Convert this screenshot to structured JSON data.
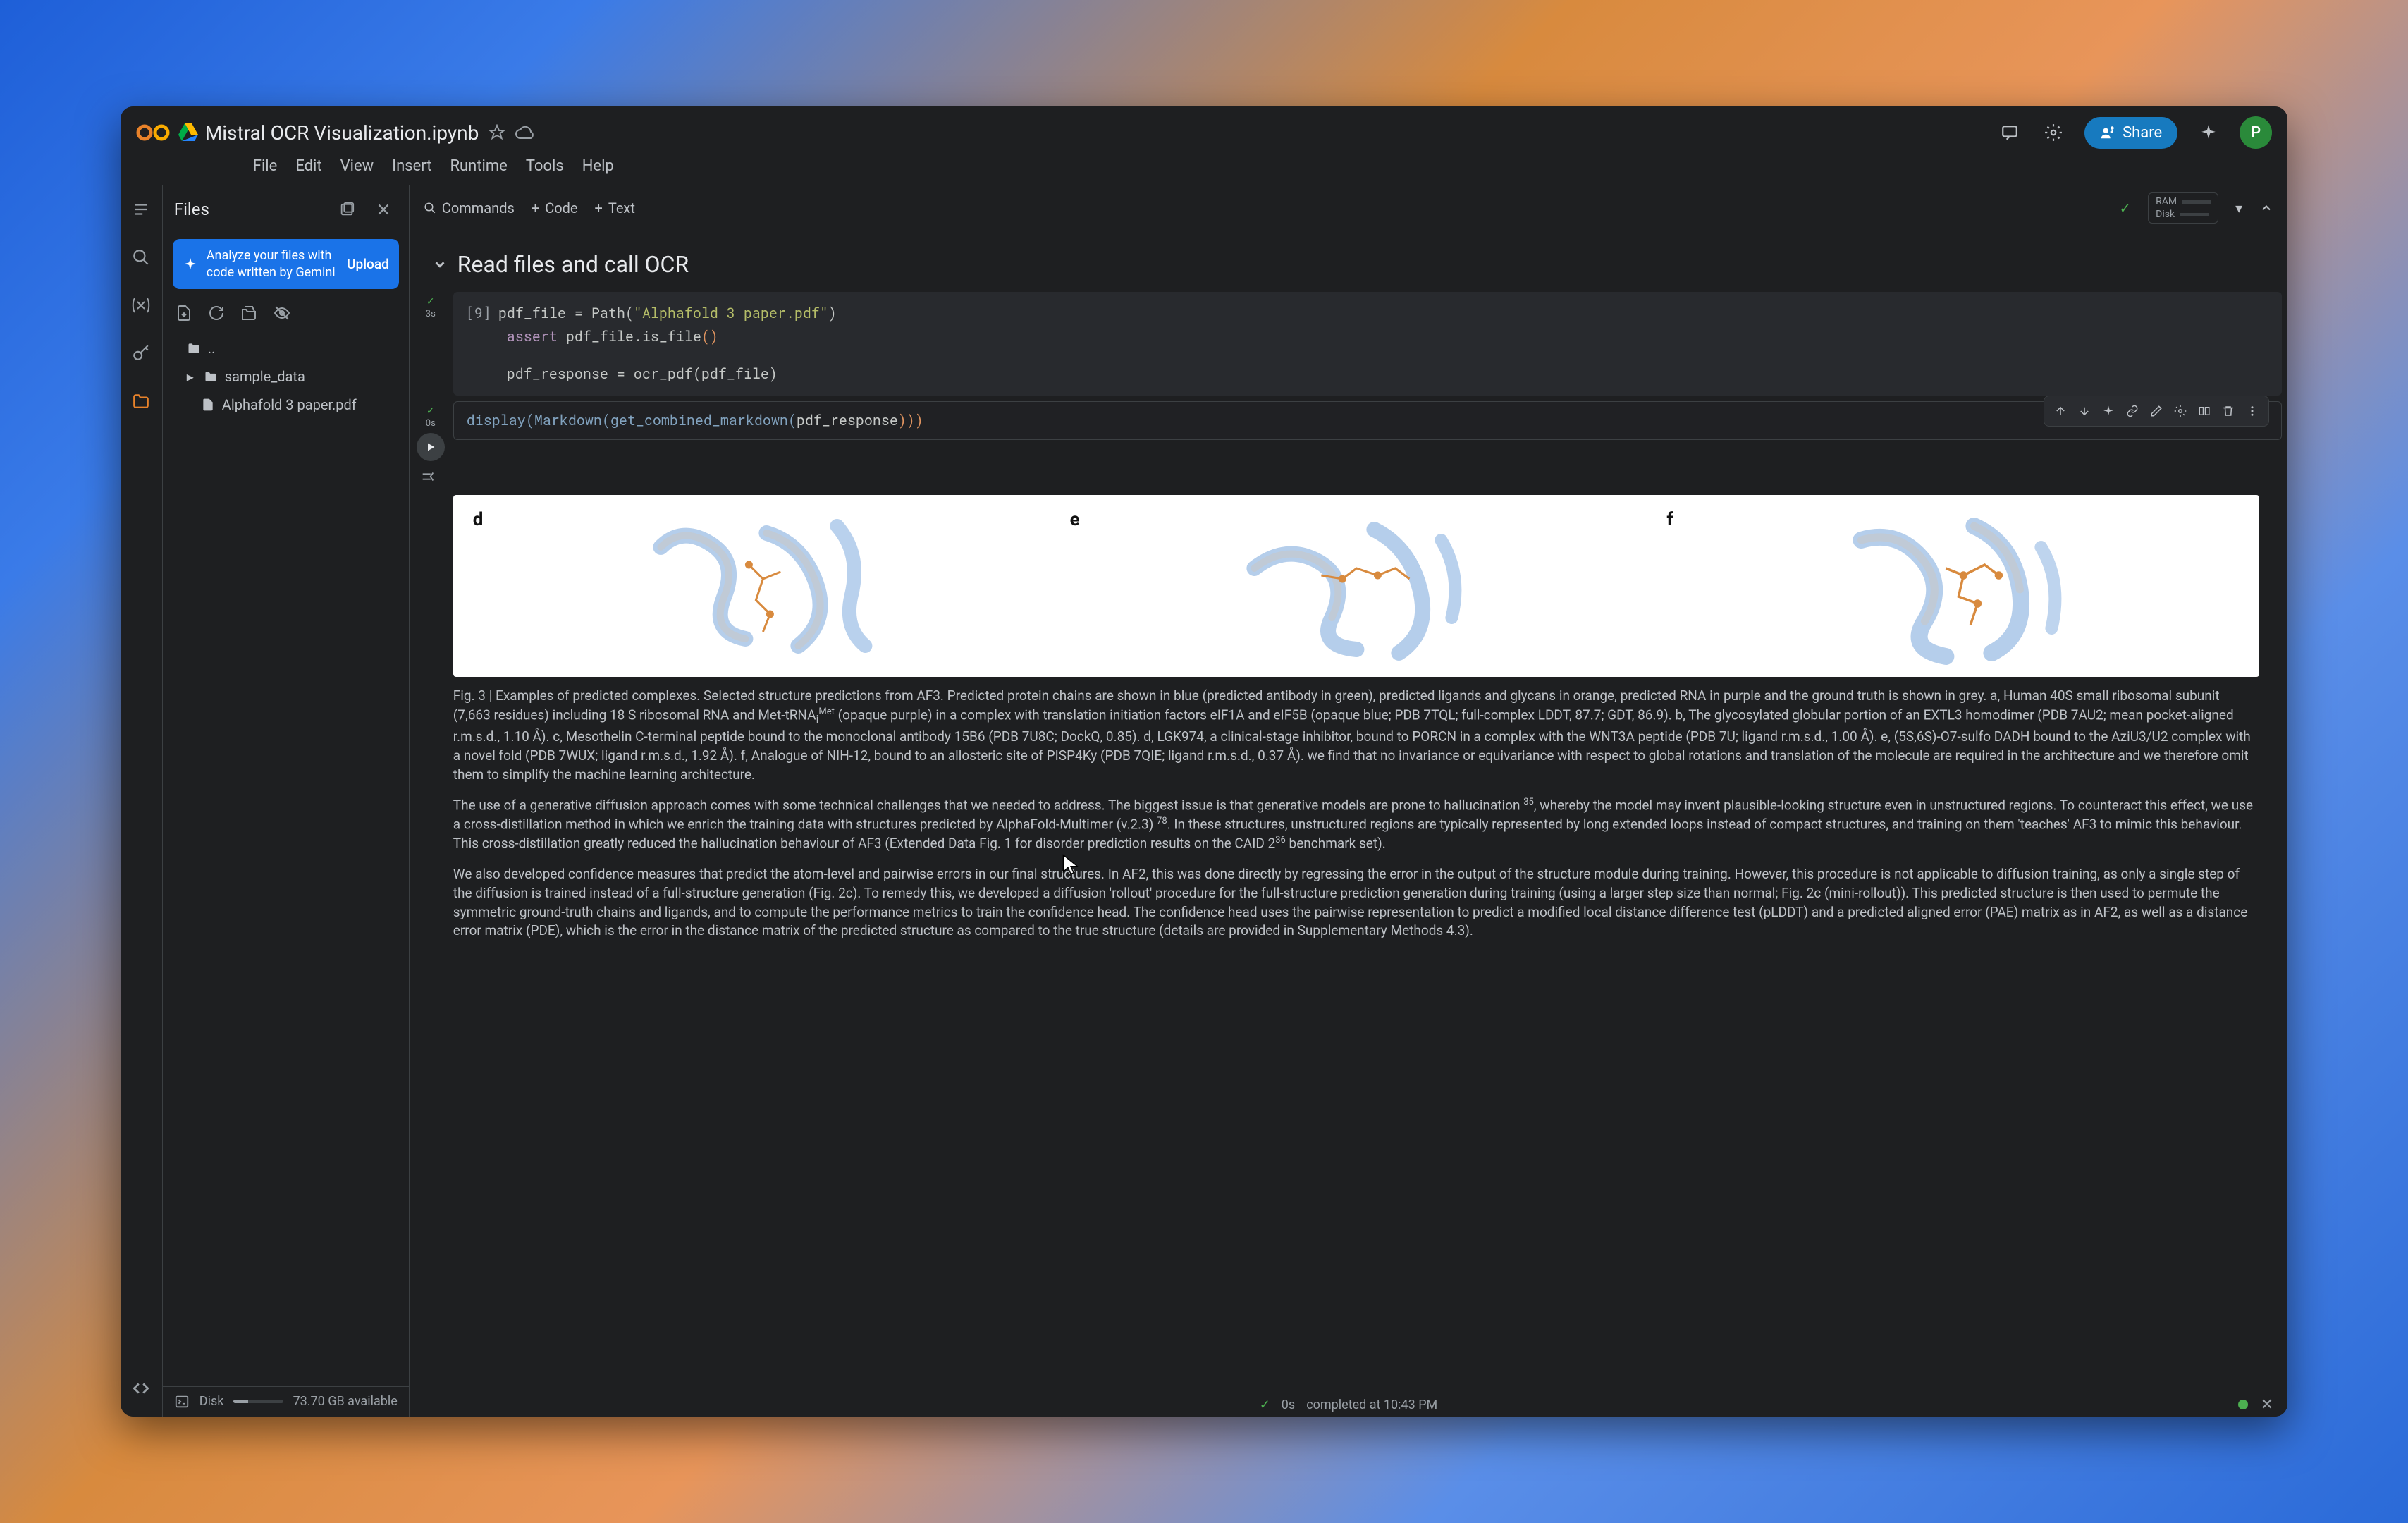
{
  "header": {
    "filename": "Mistral OCR Visualization.ipynb",
    "share_label": "Share",
    "avatar_initial": "P"
  },
  "menu": {
    "file": "File",
    "edit": "Edit",
    "view": "View",
    "insert": "Insert",
    "runtime": "Runtime",
    "tools": "Tools",
    "help": "Help"
  },
  "files_panel": {
    "title": "Files",
    "gemini_text": "Analyze your files with code written by Gemini",
    "upload": "Upload",
    "tree": {
      "parent": "..",
      "folder": "sample_data",
      "file": "Alphafold 3 paper.pdf"
    },
    "disk_label": "Disk",
    "disk_avail": "73.70 GB available"
  },
  "toolbar": {
    "commands": "Commands",
    "code": "Code",
    "text": "Text",
    "ram": "RAM",
    "disk": "Disk"
  },
  "section": {
    "title": "Read files and call OCR"
  },
  "cell1": {
    "prompt": "[9]",
    "time": "3s",
    "code_l1a": "pdf_file ",
    "code_l1b": "= Path(",
    "code_l1c": "\"Alphafold 3 paper.pdf\"",
    "code_l1d": ")",
    "code_l2a": "assert",
    "code_l2b": " pdf_file.is_file",
    "code_l2c": "()",
    "code_l3a": "pdf_response ",
    "code_l3b": "= ocr_pdf(",
    "code_l3c": "pdf_file",
    "code_l3d": ")"
  },
  "cell2": {
    "time": "0s",
    "code_a": "display(",
    "code_b": "Markdown(",
    "code_c": "get_combined_markdown(",
    "code_d": "pdf_response",
    "code_e": ")))"
  },
  "figure": {
    "labels": {
      "d": "d",
      "e": "e",
      "f": "f"
    }
  },
  "output": {
    "p1": "Fig. 3 | Examples of predicted complexes. Selected structure predictions from AF3. Predicted protein chains are shown in blue (predicted antibody in green), predicted ligands and glycans in orange, predicted RNA in purple and the ground truth is shown in grey. a, Human 40S small ribosomal subunit (7,663 residues) including 18 S ribosomal RNA and Met-tRNA",
    "p1_sup": "Met",
    "p1b": " (opaque purple) in a complex with translation initiation factors eIF1A and eIF5B (opaque blue; PDB 7TQL; full-complex LDDT, 87.7; GDT, 86.9). b, The glycosylated globular portion of an EXTL3 homodimer (PDB 7AU2; mean pocket-aligned r.m.s.d., 1.10 Å). c, Mesothelin C-terminal peptide bound to the monoclonal antibody 15B6 (PDB 7U8C; DockQ, 0.85). d, LGK974, a clinical-stage inhibitor, bound to PORCN in a complex with the WNT3A peptide (PDB 7U; ligand r.m.s.d., 1.00 Å). e, (5S,6S)-O7-sulfo DADH bound to the AziU3/U2 complex with a novel fold (PDB 7WUX; ligand r.m.s.d., 1.92 Å). f, Analogue of NIH-12, bound to an allosteric site of PISP4Ky (PDB 7QIE; ligand r.m.s.d., 0.37 Å). we find that no invariance or equivariance with respect to global rotations and translation of the molecule are required in the architecture and we therefore omit them to simplify the machine learning architecture.",
    "p2a": "The use of a generative diffusion approach comes with some technical challenges that we needed to address. The biggest issue is that generative models are prone to hallucination ",
    "p2_sup1": "35",
    "p2b": ", whereby the model may invent plausible-looking structure even in unstructured regions. To counteract this effect, we use a cross-distillation method in which we enrich the training data with structures predicted by AlphaFold-Multimer (v.2.3) ",
    "p2_sup2": "78",
    "p2c": ". In these structures, unstructured regions are typically represented by long extended loops instead of compact structures, and training on them 'teaches' AF3 to mimic this behaviour. This cross-distillation greatly reduced the hallucination behaviour of AF3 (Extended Data Fig. 1 for disorder prediction results on the CAID 2",
    "p2_sup3": "36",
    "p2d": " benchmark set).",
    "p3": "We also developed confidence measures that predict the atom-level and pairwise errors in our final structures. In AF2, this was done directly by regressing the error in the output of the structure module during training. However, this procedure is not applicable to diffusion training, as only a single step of the diffusion is trained instead of a full-structure generation (Fig. 2c). To remedy this, we developed a diffusion 'rollout' procedure for the full-structure prediction generation during training (using a larger step size than normal; Fig. 2c (mini-rollout)). This predicted structure is then used to permute the symmetric ground-truth chains and ligands, and to compute the performance metrics to train the confidence head. The confidence head uses the pairwise representation to predict a modified local distance difference test (pLDDT) and a predicted aligned error (PAE) matrix as in AF2, as well as a distance error matrix (PDE), which is the error in the distance matrix of the predicted structure as compared to the true structure (details are provided in Supplementary Methods 4.3)."
  },
  "status": {
    "time": "0s",
    "text": "completed at 10:43 PM"
  }
}
